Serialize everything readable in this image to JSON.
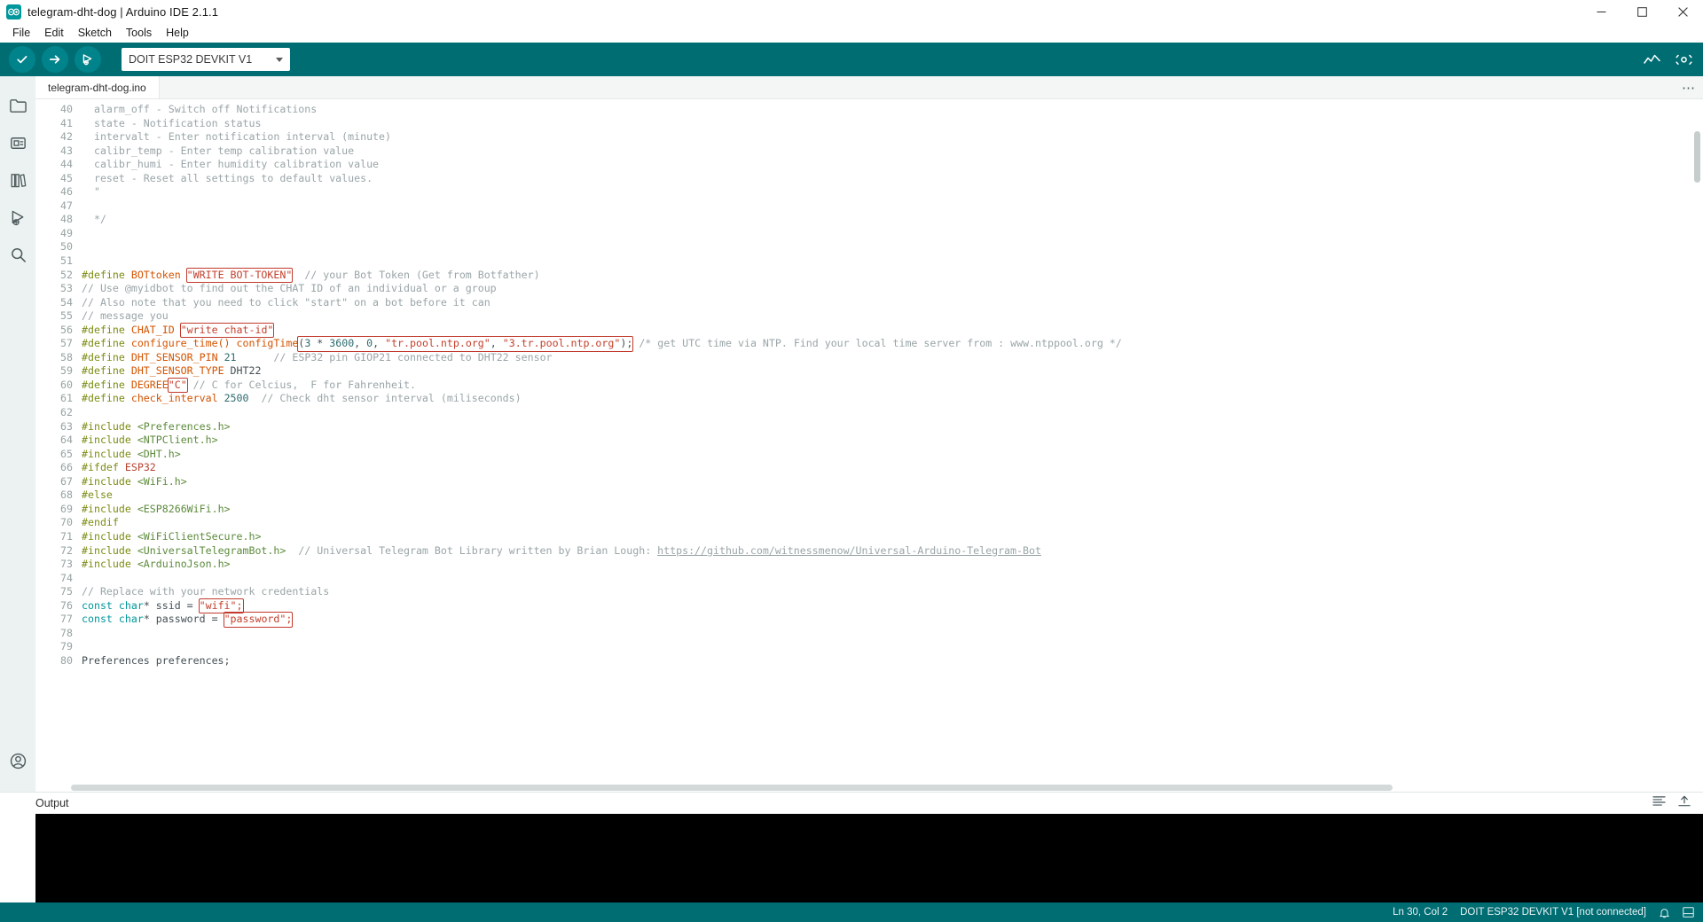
{
  "window": {
    "title": "telegram-dht-dog | Arduino IDE 2.1.1",
    "logo_icon": "arduino-logo-icon",
    "minimize_icon": "minimize-icon",
    "maximize_icon": "maximize-icon",
    "close_icon": "close-icon"
  },
  "menubar": {
    "items": [
      {
        "label": "File"
      },
      {
        "label": "Edit"
      },
      {
        "label": "Sketch"
      },
      {
        "label": "Tools"
      },
      {
        "label": "Help"
      }
    ]
  },
  "toolbar": {
    "verify_icon": "verify-checkmark-icon",
    "upload_icon": "upload-arrow-icon",
    "debug_icon": "debug-icon",
    "board_selector_value": "DOIT ESP32 DEVKIT V1",
    "board_selector_caret": "chevron-down-icon",
    "serial_plotter_icon": "serial-plotter-icon",
    "serial_monitor_icon": "serial-monitor-icon",
    "accent_color": "#006d73",
    "button_color": "#00838a"
  },
  "activitybar": {
    "items": [
      {
        "name": "sketchbook",
        "icon": "folder-icon"
      },
      {
        "name": "boards-manager",
        "icon": "boards-manager-icon"
      },
      {
        "name": "library-manager",
        "icon": "library-books-icon"
      },
      {
        "name": "debug",
        "icon": "debug-play-icon"
      },
      {
        "name": "search",
        "icon": "search-magnifier-icon"
      }
    ],
    "bottom": {
      "name": "account",
      "icon": "account-circle-icon"
    }
  },
  "tabs": [
    {
      "label": "telegram-dht-dog.ino",
      "active": true
    }
  ],
  "tabbar": {
    "more_icon": "ellipsis-horizontal-icon"
  },
  "editor": {
    "first_line": 40,
    "lines": [
      {
        "n": 40,
        "tokens": [
          {
            "t": "com",
            "s": "  alarm_off - Switch off Notifications"
          }
        ]
      },
      {
        "n": 41,
        "tokens": [
          {
            "t": "com",
            "s": "  state - Notification status"
          }
        ]
      },
      {
        "n": 42,
        "tokens": [
          {
            "t": "com",
            "s": "  intervalt - Enter notification interval (minute)"
          }
        ]
      },
      {
        "n": 43,
        "tokens": [
          {
            "t": "com",
            "s": "  calibr_temp - Enter temp calibration value"
          }
        ]
      },
      {
        "n": 44,
        "tokens": [
          {
            "t": "com",
            "s": "  calibr_humi - Enter humidity calibration value"
          }
        ]
      },
      {
        "n": 45,
        "tokens": [
          {
            "t": "com",
            "s": "  reset - Reset all settings to default values."
          }
        ]
      },
      {
        "n": 46,
        "tokens": [
          {
            "t": "com",
            "s": "  \""
          }
        ]
      },
      {
        "n": 47,
        "tokens": []
      },
      {
        "n": 48,
        "tokens": [
          {
            "t": "com",
            "s": "  */"
          }
        ]
      },
      {
        "n": 49,
        "tokens": []
      },
      {
        "n": 50,
        "tokens": []
      },
      {
        "n": 51,
        "tokens": []
      },
      {
        "n": 52,
        "tokens": [
          {
            "t": "pre",
            "s": "#define "
          },
          {
            "t": "name",
            "s": "BOTtoken"
          },
          {
            "t": "plain",
            "s": " "
          },
          {
            "t": "str",
            "s": "\"WRITE BOT-TOKEN\"",
            "box": true
          },
          {
            "t": "plain",
            "s": "  "
          },
          {
            "t": "com",
            "s": "// your Bot Token (Get from Botfather)"
          }
        ]
      },
      {
        "n": 53,
        "tokens": [
          {
            "t": "com",
            "s": "// Use @myidbot to find out the CHAT ID of an individual or a group"
          }
        ]
      },
      {
        "n": 54,
        "tokens": [
          {
            "t": "com",
            "s": "// Also note that you need to click \"start\" on a bot before it can"
          }
        ]
      },
      {
        "n": 55,
        "tokens": [
          {
            "t": "com",
            "s": "// message you"
          }
        ]
      },
      {
        "n": 56,
        "tokens": [
          {
            "t": "pre",
            "s": "#define "
          },
          {
            "t": "name",
            "s": "CHAT_ID"
          },
          {
            "t": "plain",
            "s": " "
          },
          {
            "t": "str",
            "s": "\"write chat-id\"",
            "box": true
          }
        ]
      },
      {
        "n": 57,
        "tokens": [
          {
            "t": "pre",
            "s": "#define "
          },
          {
            "t": "name",
            "s": "configure_time() "
          },
          {
            "t": "fn",
            "s": "configTime"
          },
          {
            "t": "boxgroup",
            "s": "(3 * 3600, 0, \"tr.pool.ntp.org\", \"3.tr.pool.ntp.org\");",
            "box": true
          },
          {
            "t": "plain",
            "s": " "
          },
          {
            "t": "com",
            "s": "/* get UTC time via NTP. Find your local time server from : www.ntppool.org */"
          }
        ]
      },
      {
        "n": 58,
        "tokens": [
          {
            "t": "pre",
            "s": "#define "
          },
          {
            "t": "name",
            "s": "DHT_SENSOR_PIN"
          },
          {
            "t": "plain",
            "s": " "
          },
          {
            "t": "num",
            "s": "21"
          },
          {
            "t": "plain",
            "s": "      "
          },
          {
            "t": "com",
            "s": "// ESP32 pin GIOP21 connected to DHT22 sensor"
          }
        ]
      },
      {
        "n": 59,
        "tokens": [
          {
            "t": "pre",
            "s": "#define "
          },
          {
            "t": "name",
            "s": "DHT_SENSOR_TYPE"
          },
          {
            "t": "plain",
            "s": " DHT22"
          }
        ]
      },
      {
        "n": 60,
        "tokens": [
          {
            "t": "pre",
            "s": "#define "
          },
          {
            "t": "name",
            "s": "DEGREE"
          },
          {
            "t": "str",
            "s": "\"C\"",
            "box": true
          },
          {
            "t": "plain",
            "s": " "
          },
          {
            "t": "com",
            "s": "// C for Celcius,  F for Fahrenheit."
          }
        ]
      },
      {
        "n": 61,
        "tokens": [
          {
            "t": "pre",
            "s": "#define "
          },
          {
            "t": "name",
            "s": "check_interval"
          },
          {
            "t": "plain",
            "s": " "
          },
          {
            "t": "num",
            "s": "2500"
          },
          {
            "t": "plain",
            "s": "  "
          },
          {
            "t": "com",
            "s": "// Check dht sensor interval (miliseconds)"
          }
        ]
      },
      {
        "n": 62,
        "tokens": []
      },
      {
        "n": 63,
        "tokens": [
          {
            "t": "pre",
            "s": "#include "
          },
          {
            "t": "inc",
            "s": "<Preferences.h>"
          }
        ]
      },
      {
        "n": 64,
        "tokens": [
          {
            "t": "pre",
            "s": "#include "
          },
          {
            "t": "inc",
            "s": "<NTPClient.h>"
          }
        ]
      },
      {
        "n": 65,
        "tokens": [
          {
            "t": "pre",
            "s": "#include "
          },
          {
            "t": "inc",
            "s": "<DHT.h>"
          }
        ]
      },
      {
        "n": 66,
        "tokens": [
          {
            "t": "pre",
            "s": "#ifdef "
          },
          {
            "t": "id",
            "s": "ESP32"
          }
        ]
      },
      {
        "n": 67,
        "tokens": [
          {
            "t": "pre",
            "s": "#include "
          },
          {
            "t": "inc",
            "s": "<WiFi.h>"
          }
        ]
      },
      {
        "n": 68,
        "tokens": [
          {
            "t": "pre",
            "s": "#else"
          }
        ]
      },
      {
        "n": 69,
        "tokens": [
          {
            "t": "pre",
            "s": "#include "
          },
          {
            "t": "inc",
            "s": "<ESP8266WiFi.h>"
          }
        ]
      },
      {
        "n": 70,
        "tokens": [
          {
            "t": "pre",
            "s": "#endif"
          }
        ]
      },
      {
        "n": 71,
        "tokens": [
          {
            "t": "pre",
            "s": "#include "
          },
          {
            "t": "inc",
            "s": "<WiFiClientSecure.h>"
          }
        ]
      },
      {
        "n": 72,
        "tokens": [
          {
            "t": "pre",
            "s": "#include "
          },
          {
            "t": "inc",
            "s": "<UniversalTelegramBot.h>"
          },
          {
            "t": "plain",
            "s": "  "
          },
          {
            "t": "com",
            "s": "// Universal Telegram Bot Library written by Brian Lough: "
          },
          {
            "t": "link",
            "s": "https://github.com/witnessmenow/Universal-Arduino-Telegram-Bot"
          }
        ]
      },
      {
        "n": 73,
        "tokens": [
          {
            "t": "pre",
            "s": "#include "
          },
          {
            "t": "inc",
            "s": "<ArduinoJson.h>"
          }
        ]
      },
      {
        "n": 74,
        "tokens": []
      },
      {
        "n": 75,
        "tokens": [
          {
            "t": "com",
            "s": "// Replace with your network credentials"
          }
        ]
      },
      {
        "n": 76,
        "tokens": [
          {
            "t": "kw",
            "s": "const"
          },
          {
            "t": "plain",
            "s": " "
          },
          {
            "t": "kw",
            "s": "char"
          },
          {
            "t": "plain",
            "s": "* ssid = "
          },
          {
            "t": "str",
            "s": "\"wifi\";",
            "box": true
          }
        ]
      },
      {
        "n": 77,
        "tokens": [
          {
            "t": "kw",
            "s": "const"
          },
          {
            "t": "plain",
            "s": " "
          },
          {
            "t": "kw",
            "s": "char"
          },
          {
            "t": "plain",
            "s": "* password = "
          },
          {
            "t": "str",
            "s": "\"password\";",
            "box": true
          }
        ]
      },
      {
        "n": 78,
        "tokens": []
      },
      {
        "n": 79,
        "tokens": []
      },
      {
        "n": 80,
        "tokens": [
          {
            "t": "plain",
            "s": "Preferences preferences;"
          }
        ]
      }
    ]
  },
  "output": {
    "title": "Output",
    "clear_icon": "clear-output-icon",
    "expand_icon": "expand-panel-icon",
    "content": ""
  },
  "statusbar": {
    "cursor_position": "Ln 30, Col 2",
    "board_status": "DOIT ESP32 DEVKIT V1 [not connected]",
    "notification_icon": "bell-icon",
    "panel_toggle_icon": "panel-toggle-icon"
  }
}
